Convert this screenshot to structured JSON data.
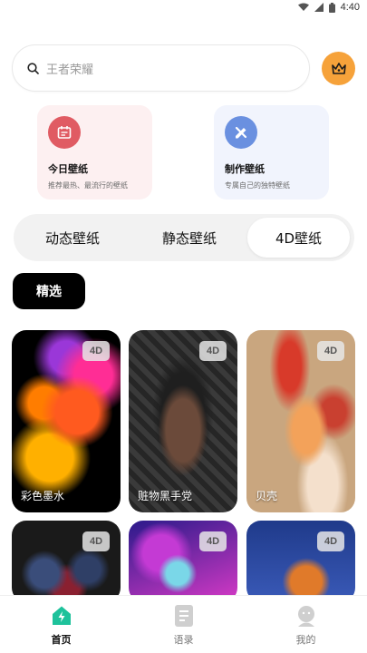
{
  "status_bar": {
    "time": "4:40"
  },
  "search": {
    "placeholder": "王者荣耀"
  },
  "features": [
    {
      "title": "今日壁纸",
      "subtitle": "推荐最热、最流行的壁纸"
    },
    {
      "title": "制作壁纸",
      "subtitle": "专属自己的独特壁纸"
    }
  ],
  "segments": [
    "动态壁纸",
    "静态壁纸",
    "4D壁纸"
  ],
  "selected_segment": "4D壁纸",
  "filter": {
    "label": "精选"
  },
  "wallpapers": [
    {
      "name": "彩色墨水",
      "badge": "4D"
    },
    {
      "name": "赃物黑手党",
      "badge": "4D"
    },
    {
      "name": "贝壳",
      "badge": "4D"
    },
    {
      "name": "",
      "badge": "4D"
    },
    {
      "name": "",
      "badge": "4D"
    },
    {
      "name": "",
      "badge": "4D"
    }
  ],
  "tabs": [
    {
      "label": "首页",
      "icon": "home-icon"
    },
    {
      "label": "语录",
      "icon": "document-icon"
    },
    {
      "label": "我的",
      "icon": "user-icon"
    }
  ],
  "colors": {
    "accent_orange": "#f6a23a",
    "active_tab": "#1ec29b"
  }
}
